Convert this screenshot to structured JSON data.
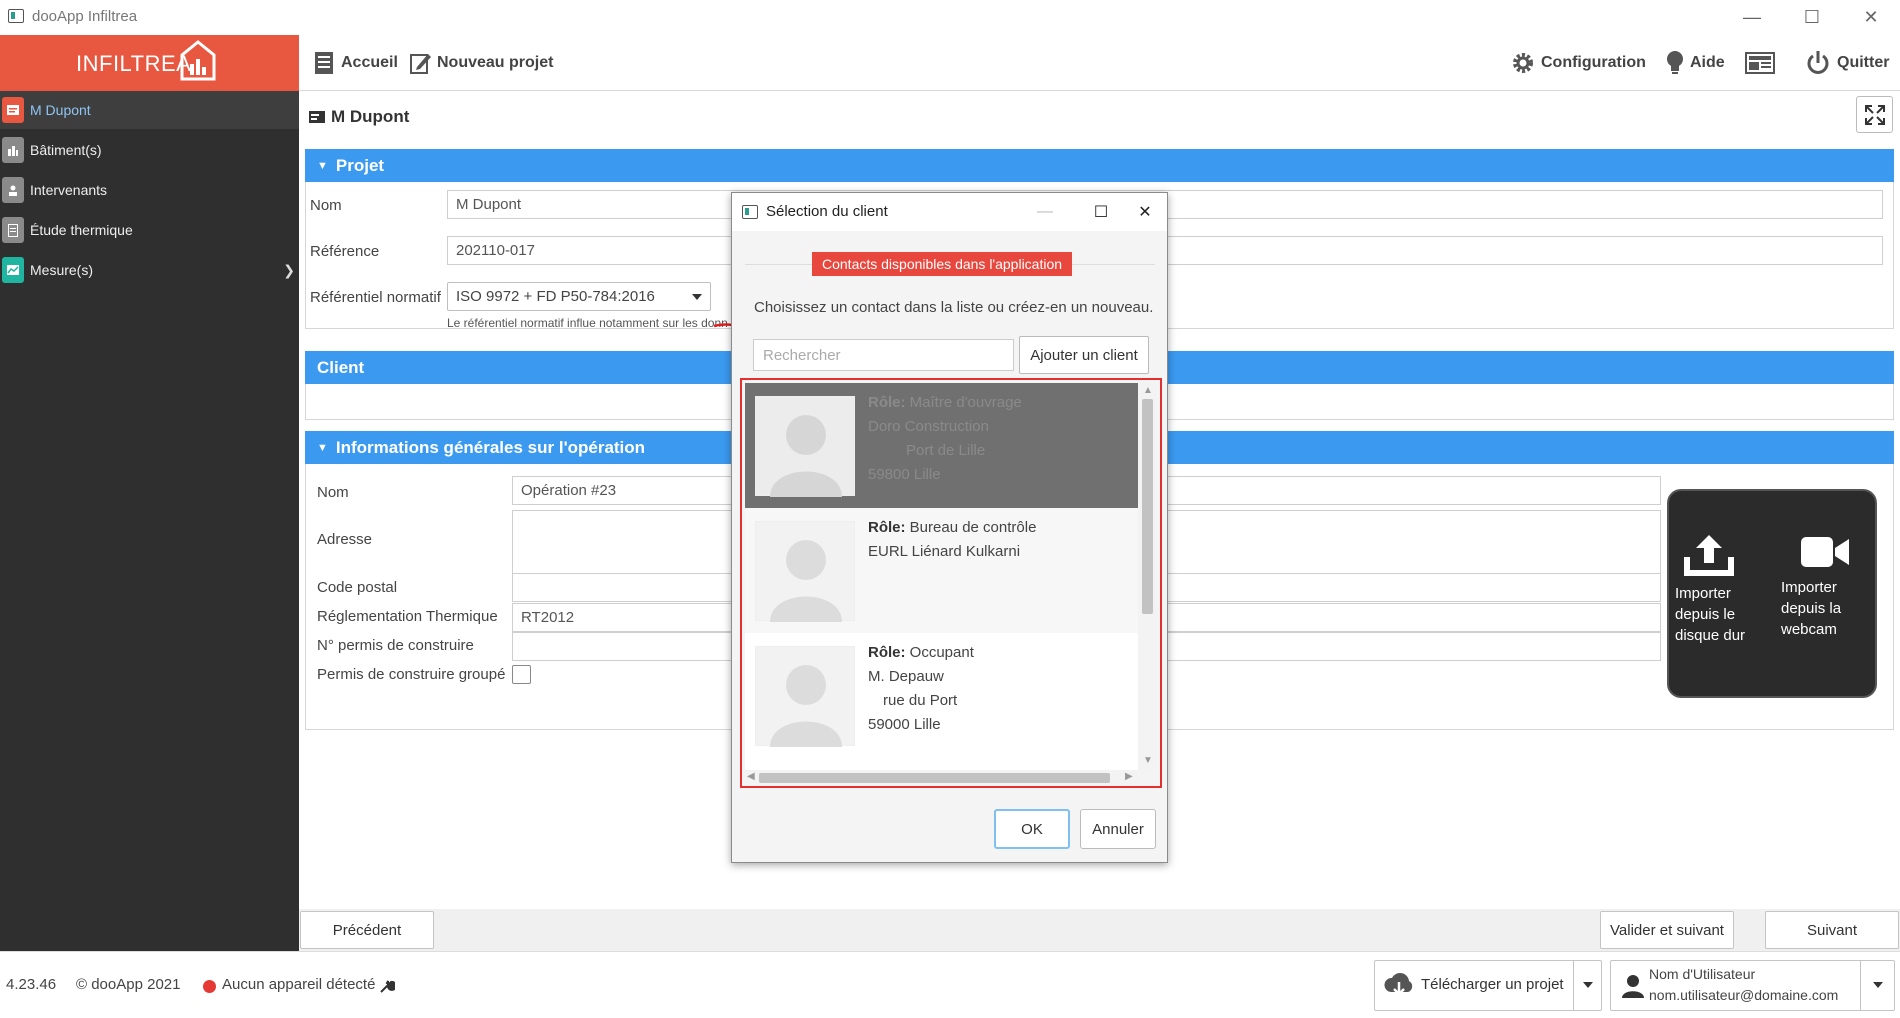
{
  "window": {
    "title": "dooApp Infiltrea"
  },
  "logo": {
    "text": "INFILTREA"
  },
  "nav": {
    "home": "Accueil",
    "new_project": "Nouveau projet",
    "config": "Configuration",
    "help": "Aide",
    "quit": "Quitter"
  },
  "sidebar": {
    "items": [
      {
        "label": "M Dupont",
        "color": "#e8573f"
      },
      {
        "label": "Bâtiment(s)",
        "color": "#8a8a8a"
      },
      {
        "label": "Intervenants",
        "color": "#8a8a8a"
      },
      {
        "label": "Étude thermique",
        "color": "#8a8a8a"
      },
      {
        "label": "Mesure(s)",
        "color": "#1fb5a0"
      }
    ]
  },
  "main": {
    "title": "M Dupont",
    "projet": {
      "header": "Projet",
      "nom_label": "Nom",
      "nom_value": "M Dupont",
      "ref_label": "Référence",
      "ref_value": "202110-017",
      "refnorm_label": "Référentiel normatif",
      "refnorm_value": "ISO 9972 + FD P50-784:2016",
      "hint": "Le référentiel normatif influe notamment sur les donn"
    },
    "client": {
      "header": "Client"
    },
    "operation": {
      "header": "Informations générales sur l'opération",
      "nom_label": "Nom",
      "nom_value": "Opération #23",
      "adresse_label": "Adresse",
      "cp_label": "Code postal",
      "rt_label": "Réglementation Thermique",
      "rt_value": "RT2012",
      "permis_label": "N° permis de construire",
      "groupe_label": "Permis de construire groupé"
    },
    "import": {
      "disk": "Importer depuis le disque dur",
      "webcam": "Importer depuis la webcam"
    },
    "buttons": {
      "prev": "Précédent",
      "validate_next": "Valider et suivant",
      "next": "Suivant"
    }
  },
  "status": {
    "version": "4.23.46",
    "copyright": "© dooApp 2021",
    "device": "Aucun appareil détecté",
    "download": "Télécharger un projet",
    "user_name": "Nom d'Utilisateur",
    "user_email": "nom.utilisateur@domaine.com"
  },
  "modal": {
    "title": "Sélection du client",
    "badge": "Contacts disponibles dans l'application",
    "instruction": "Choisissez un contact dans la liste ou créez-en un nouveau.",
    "search_placeholder": "Rechercher",
    "add_button": "Ajouter un client",
    "role_label": "Rôle:",
    "contacts": [
      {
        "role": "Maître d'ouvrage",
        "name": "Doro Construction",
        "street": "Port de Lille",
        "city": "59800 Lille",
        "selected": true
      },
      {
        "role": "Bureau de contrôle",
        "name": "EURL Liénard Kulkarni",
        "street": "",
        "city": "",
        "selected": false
      },
      {
        "role": "Occupant",
        "name": "M. Depauw",
        "street": "rue du Port",
        "city": "59000 Lille",
        "selected": false
      }
    ],
    "ok": "OK",
    "cancel": "Annuler"
  }
}
